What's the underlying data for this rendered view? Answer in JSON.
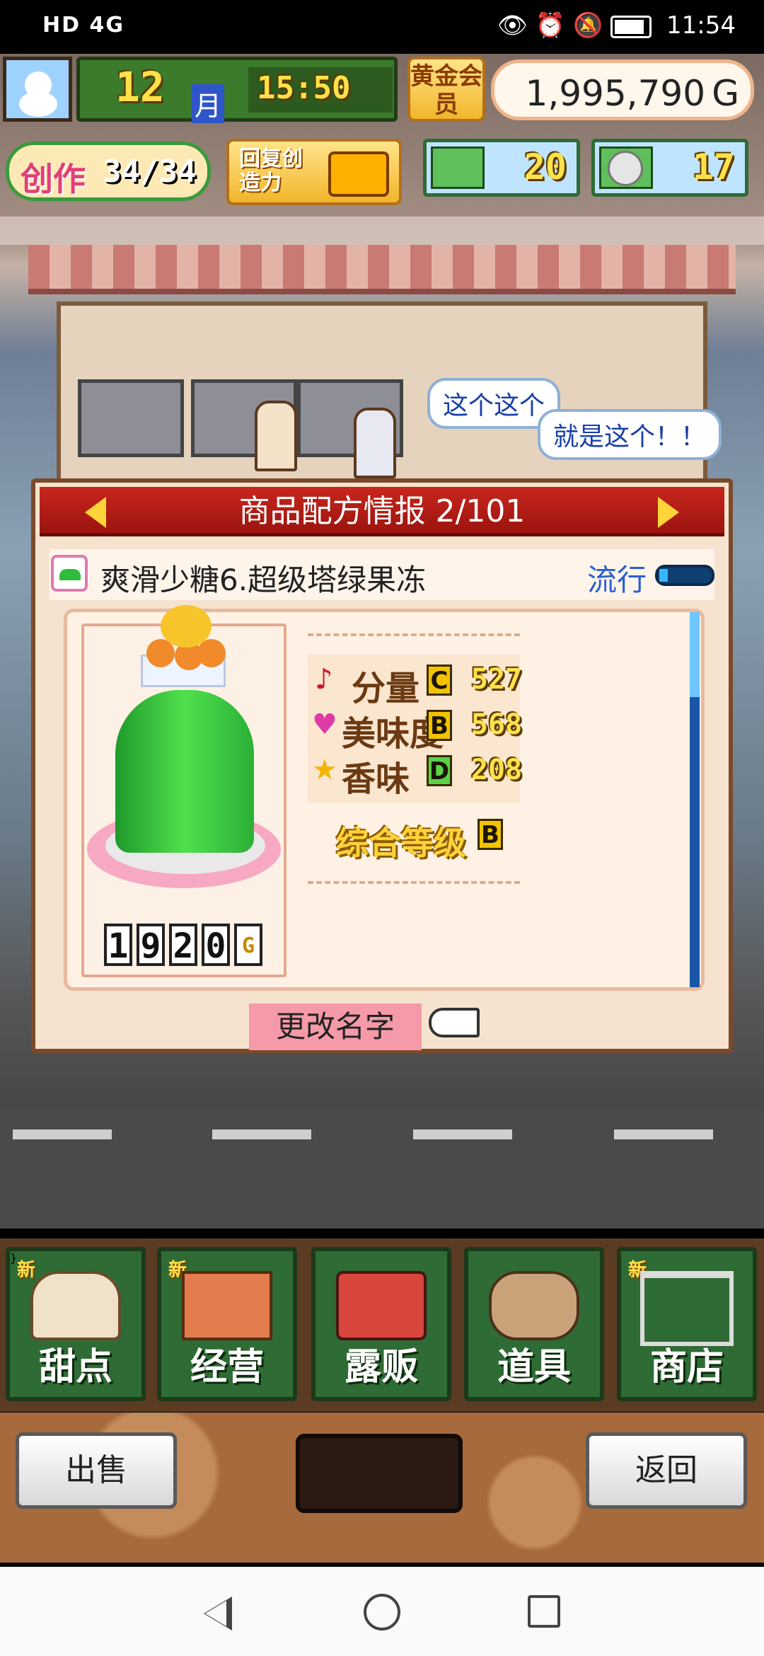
{
  "status_bar": {
    "left_icons": "HD 4G",
    "time": "11:54"
  },
  "hud": {
    "month_number": "12",
    "month_unit": "月",
    "clock": "15:50",
    "member_badge": "黄金会员",
    "money": "1,995,790",
    "money_unit": "G",
    "create_label": "创作",
    "create_count": "34/34",
    "restore_label": "回复创造力",
    "ticket_count": "20",
    "medal_count": "17"
  },
  "speech": {
    "bubble1": "这个这个",
    "bubble2": "就是这个！！"
  },
  "popup": {
    "title": "商品配方情报 2/101",
    "product_name": "爽滑少糖6.超级塔绿果冻",
    "trend_label": "流行",
    "stats": [
      {
        "label": "分量",
        "grade": "C",
        "value": "527"
      },
      {
        "label": "美味度",
        "grade": "B",
        "value": "568"
      },
      {
        "label": "香味",
        "grade": "D",
        "value": "208"
      }
    ],
    "overall_label": "综合等级",
    "overall_grade": "B",
    "price_digits": [
      "1",
      "9",
      "2",
      "0"
    ],
    "price_unit": "G",
    "rename_button": "更改名字"
  },
  "menu": {
    "items": [
      {
        "label": "甜点",
        "new": "新"
      },
      {
        "label": "经营",
        "new": "新"
      },
      {
        "label": "露贩",
        "new": ""
      },
      {
        "label": "道具",
        "new": ""
      },
      {
        "label": "商店",
        "new": "新"
      }
    ]
  },
  "actions": {
    "sell": "出售",
    "back": "返回"
  }
}
